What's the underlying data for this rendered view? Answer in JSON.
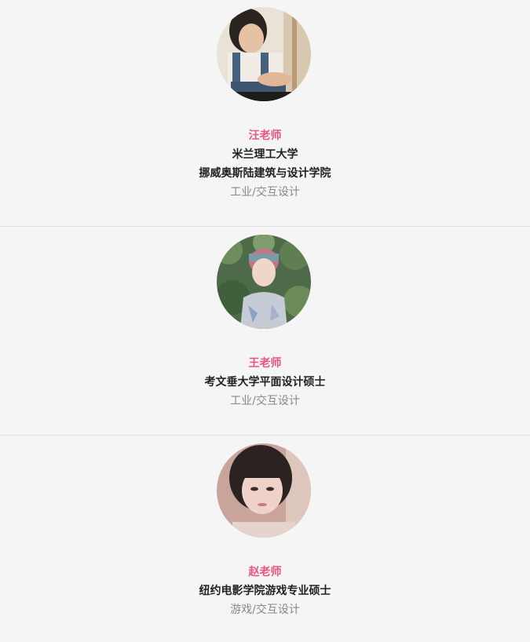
{
  "teachers": [
    {
      "name": "汪老师",
      "school_lines": [
        "米兰理工大学",
        "挪威奥斯陆建筑与设计学院"
      ],
      "major": "工业/交互设计",
      "avatar_icon": "teacher-photo-1"
    },
    {
      "name": "王老师",
      "school_lines": [
        "考文垂大学平面设计硕士"
      ],
      "major": "工业/交互设计",
      "avatar_icon": "teacher-photo-2"
    },
    {
      "name": "赵老师",
      "school_lines": [
        "纽约电影学院游戏专业硕士"
      ],
      "major": "游戏/交互设计",
      "avatar_icon": "teacher-photo-3"
    }
  ],
  "colors": {
    "background": "#f6f5f5",
    "name_accent": "#e8557e",
    "divider": "#e2e1e1",
    "major_text": "#888888"
  }
}
